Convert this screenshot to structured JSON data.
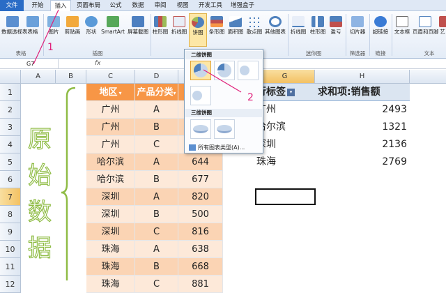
{
  "menu": {
    "tabs": [
      "文件",
      "开始",
      "插入",
      "页面布局",
      "公式",
      "数据",
      "审阅",
      "视图",
      "开发工具",
      "增强盒子"
    ]
  },
  "ribbon": {
    "buttons": [
      "数据透视表",
      "表格",
      "图片",
      "剪贴画",
      "形状",
      "SmartArt",
      "屏幕截图",
      "柱形图",
      "折线图",
      "饼图",
      "条形图",
      "面积图",
      "散点图",
      "其他图表",
      "折线图",
      "柱形图",
      "盈亏",
      "切片器",
      "超链接",
      "文本框",
      "页眉和页脚",
      "艺"
    ],
    "groups": [
      "表格",
      "插图",
      "迷你图",
      "筛选器",
      "链接",
      "文本"
    ]
  },
  "formula_bar": {
    "name_box": "G7",
    "fx": "fx"
  },
  "columns": [
    "A",
    "B",
    "C",
    "D",
    "E",
    "F",
    "G",
    "H"
  ],
  "rows": [
    "1",
    "2",
    "3",
    "4",
    "5",
    "6",
    "7",
    "8",
    "9",
    "10",
    "11",
    "12"
  ],
  "table": {
    "headers": [
      "地区",
      "产品分类",
      "销"
    ],
    "rows": [
      [
        "广州",
        "A",
        ""
      ],
      [
        "广州",
        "B",
        ""
      ],
      [
        "广州",
        "C",
        ""
      ],
      [
        "哈尔滨",
        "A",
        "644"
      ],
      [
        "哈尔滨",
        "B",
        "677"
      ],
      [
        "深圳",
        "A",
        "820"
      ],
      [
        "深圳",
        "B",
        "500"
      ],
      [
        "深圳",
        "C",
        "816"
      ],
      [
        "珠海",
        "A",
        "638"
      ],
      [
        "珠海",
        "B",
        "668"
      ],
      [
        "珠海",
        "C",
        "881"
      ]
    ]
  },
  "side_label": [
    "原",
    "始",
    "数",
    "据"
  ],
  "pivot": {
    "headers": [
      "行标签",
      "求和项:销售额"
    ],
    "rows": [
      [
        "广州",
        "2493"
      ],
      [
        "哈尔滨",
        "1321"
      ],
      [
        "深圳",
        "2136"
      ],
      [
        "珠海",
        "2769"
      ]
    ]
  },
  "dropdown": {
    "section_2d": "二维饼图",
    "section_3d": "三维饼图",
    "all_types": "所有图表类型(A)..."
  },
  "annotations": [
    "1",
    "2"
  ]
}
